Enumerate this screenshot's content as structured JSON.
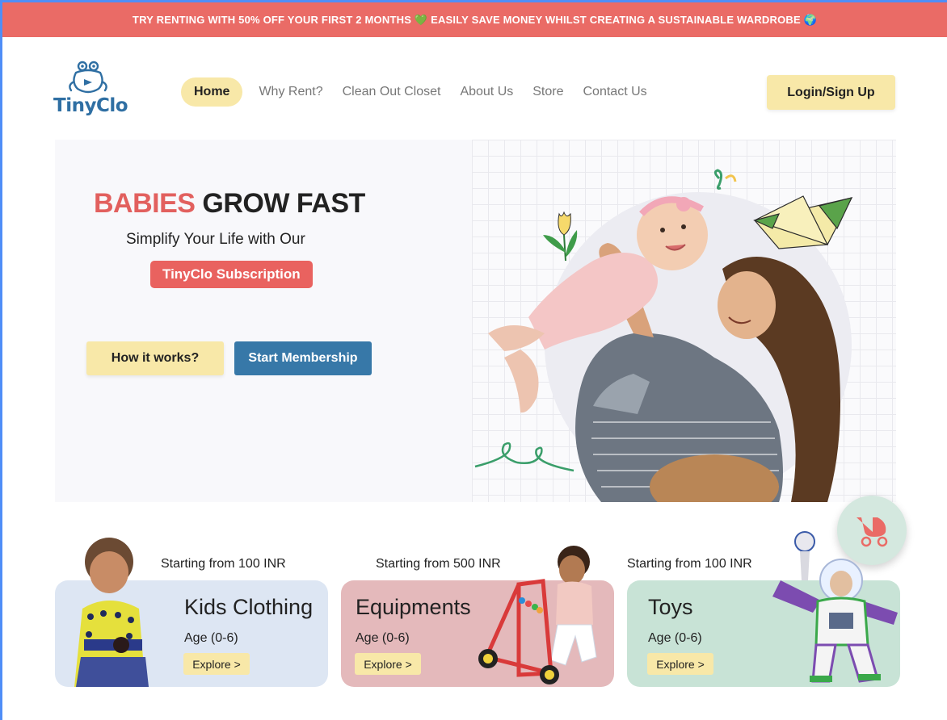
{
  "banner": {
    "text": "TRY RENTING WITH 50% OFF YOUR FIRST 2 MONTHS 💚 EASILY SAVE MONEY WHILST CREATING A SUSTAINABLE WARDROBE 🌍"
  },
  "brand": {
    "name": "TinyClo",
    "color": "#2f6fa3"
  },
  "nav": {
    "items": [
      {
        "label": "Home",
        "active": true
      },
      {
        "label": "Why Rent?",
        "active": false
      },
      {
        "label": "Clean Out Closet",
        "active": false
      },
      {
        "label": "About Us",
        "active": false
      },
      {
        "label": "Store",
        "active": false
      },
      {
        "label": "Contact Us",
        "active": false
      }
    ],
    "login_label": "Login/Sign Up"
  },
  "hero": {
    "headline_accent": "BABIES",
    "headline_rest": "GROW FAST",
    "subline": "Simplify Your Life with Our",
    "pill": "TinyClo Subscription",
    "btn_how": "How it works?",
    "btn_start": "Start Membership"
  },
  "categories": [
    {
      "price": "Starting from 100 INR",
      "title": "Kids Clothing",
      "age": "Age (0-6)",
      "cta": "Explore >",
      "color": "#dde6f3"
    },
    {
      "price": "Starting from 500 INR",
      "title": "Equipments",
      "age": "Age (0-6)",
      "cta": "Explore >",
      "color": "#e4b9bb"
    },
    {
      "price": "Starting from 100 INR",
      "title": "Toys",
      "age": "Age (0-6)",
      "cta": "Explore >",
      "color": "#c8e3d6"
    }
  ],
  "colors": {
    "banner": "#ea6b66",
    "accent_yellow": "#f8e8a8",
    "accent_blue": "#3778a8",
    "accent_red": "#e9625f"
  },
  "icons": {
    "logo": "frog-mascot-icon",
    "cart": "baby-stroller-icon"
  }
}
